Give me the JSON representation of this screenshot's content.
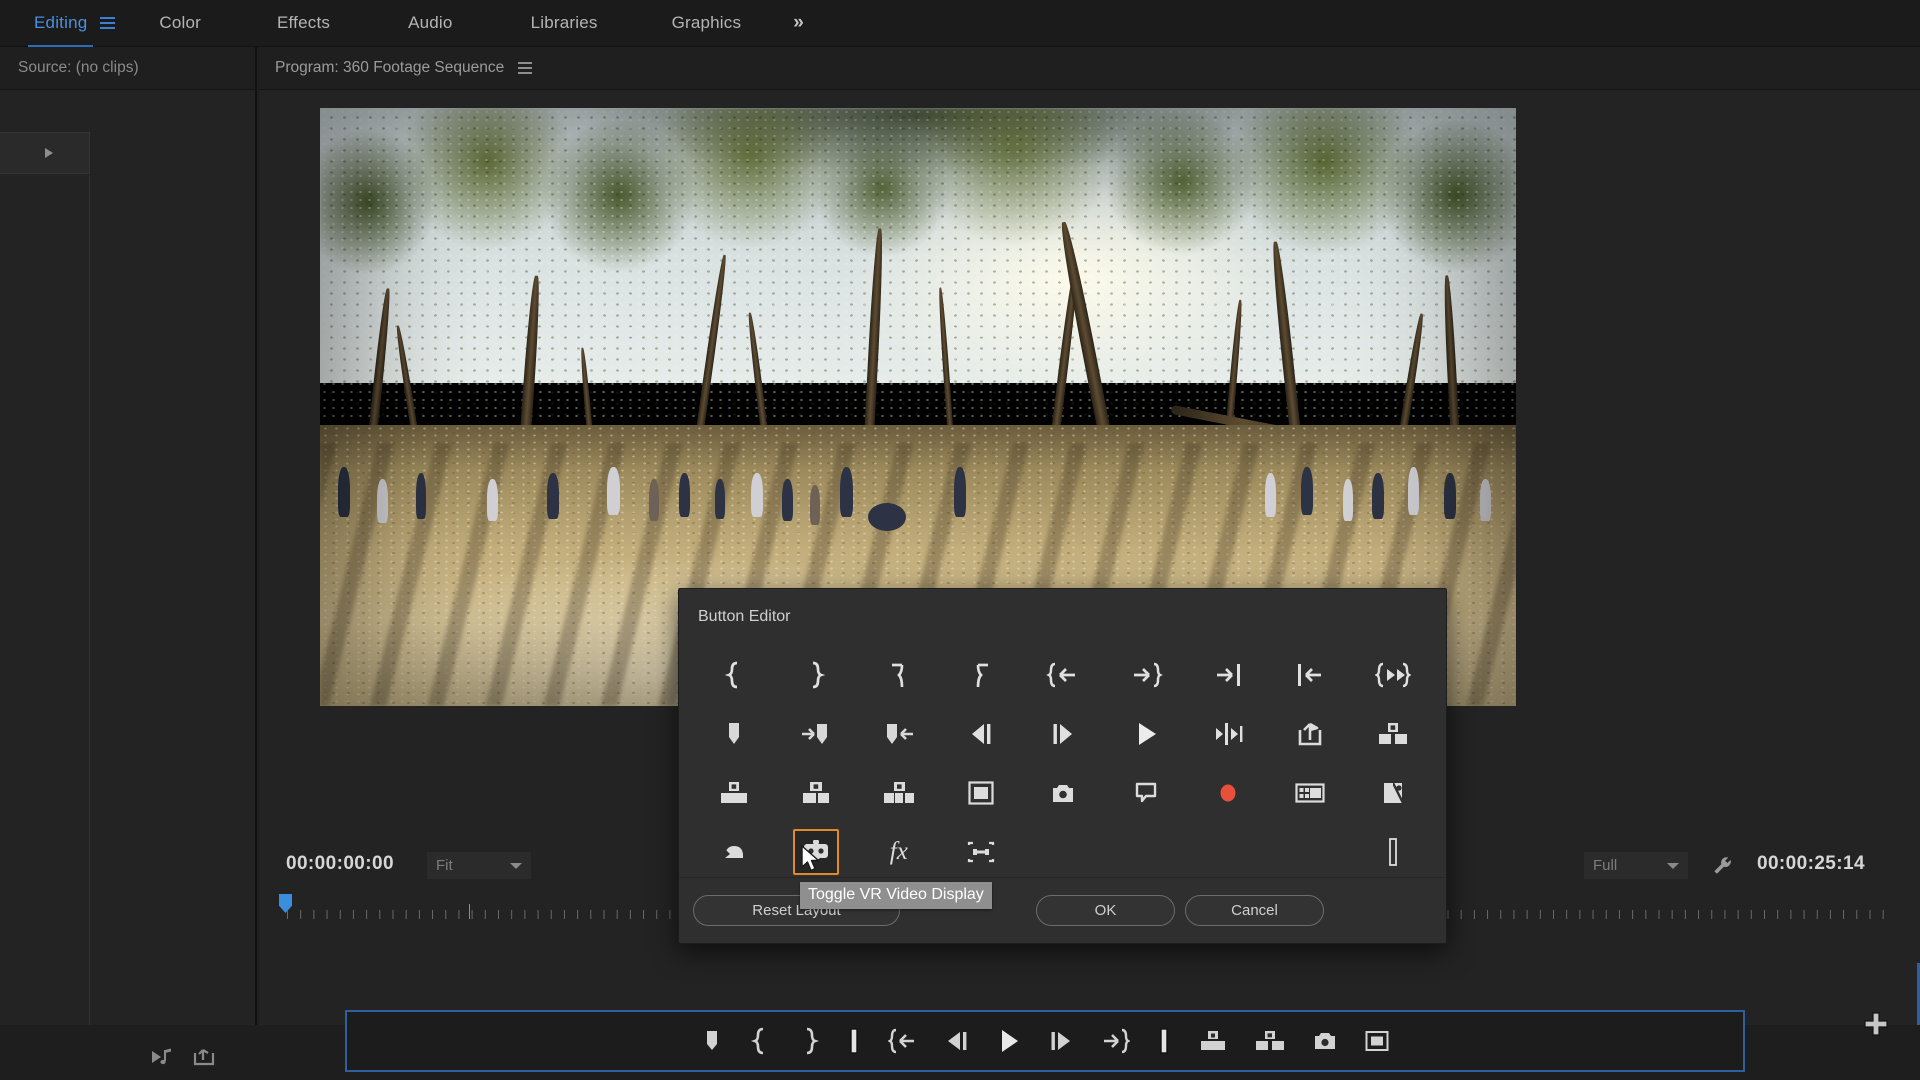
{
  "workspace": {
    "tabs": [
      {
        "label": "Editing",
        "active": true
      },
      {
        "label": "Color",
        "active": false
      },
      {
        "label": "Effects",
        "active": false
      },
      {
        "label": "Audio",
        "active": false
      },
      {
        "label": "Libraries",
        "active": false
      },
      {
        "label": "Graphics",
        "active": false
      }
    ],
    "hamburger_icon": "workspace-menu-icon",
    "overflow_label": "»",
    "active_accent": "#4a8fe0"
  },
  "source_panel": {
    "tab_label": "Source: (no clips)",
    "bottom_icons": [
      {
        "name": "export-audio-icon"
      },
      {
        "name": "export-frame-icon"
      }
    ]
  },
  "program_panel": {
    "tab_label": "Program: 360 Footage Sequence",
    "menu_icon": "panel-menu-icon",
    "timecode_current": "00:00:00:00",
    "timecode_duration": "00:00:25:14",
    "zoom_level": "Fit",
    "resolution": "Full",
    "settings_icon": "wrench-icon",
    "playhead_position_pct": 0.4
  },
  "button_bar": {
    "accent_border": "#2f5f9e",
    "buttons": [
      {
        "name": "marker-button",
        "icon": "marker"
      },
      {
        "name": "mark-in-button",
        "icon": "mark-in"
      },
      {
        "name": "mark-out-button",
        "icon": "mark-out"
      },
      {
        "name": "go-to-in-button",
        "icon": "bar-bracket"
      },
      {
        "name": "go-to-previous-marker-button",
        "icon": "bracket-left-arrow"
      },
      {
        "name": "step-back-button",
        "icon": "step-back"
      },
      {
        "name": "play-stop-button",
        "icon": "play"
      },
      {
        "name": "step-forward-button",
        "icon": "step-forward"
      },
      {
        "name": "go-to-next-marker-button",
        "icon": "arrow-right-bracket"
      },
      {
        "name": "go-to-out-button",
        "icon": "bar-bracket"
      },
      {
        "name": "lift-button",
        "icon": "lift"
      },
      {
        "name": "extract-button",
        "icon": "extract"
      },
      {
        "name": "export-frame-button",
        "icon": "camera"
      },
      {
        "name": "comparison-view-button",
        "icon": "comparison-view"
      }
    ],
    "add_icon": "add-button-icon"
  },
  "button_editor": {
    "title": "Button Editor",
    "reset_label": "Reset Layout",
    "ok_label": "OK",
    "cancel_label": "Cancel",
    "selected_index": 28,
    "selection_color": "#e08a29",
    "tooltip": "Toggle VR Video Display",
    "items": [
      {
        "name": "mark-in-button",
        "icon": "mark-in"
      },
      {
        "name": "mark-out-button",
        "icon": "mark-out"
      },
      {
        "name": "mark-clip-in-button",
        "icon": "mark-clip-right"
      },
      {
        "name": "mark-clip-out-button",
        "icon": "mark-clip-left"
      },
      {
        "name": "go-to-in-button",
        "icon": "bracket-left-arrow"
      },
      {
        "name": "go-to-out-button",
        "icon": "arrow-right-bracket"
      },
      {
        "name": "go-to-next-edit-button",
        "icon": "arrow-right-bar"
      },
      {
        "name": "go-to-previous-edit-button",
        "icon": "bar-left-arrow"
      },
      {
        "name": "play-in-to-out-button",
        "icon": "bracket-play-bracket"
      },
      {
        "name": "add-marker-button",
        "icon": "marker"
      },
      {
        "name": "go-to-next-marker-button",
        "icon": "arrow-marker"
      },
      {
        "name": "go-to-previous-marker-button",
        "icon": "marker-arrow"
      },
      {
        "name": "step-back-button",
        "icon": "step-back"
      },
      {
        "name": "step-forward-button",
        "icon": "step-forward"
      },
      {
        "name": "play-stop-toggle-button",
        "icon": "play"
      },
      {
        "name": "play-around-button",
        "icon": "play-around"
      },
      {
        "name": "export-frame-button",
        "icon": "export-frame"
      },
      {
        "name": "extract-button",
        "icon": "extract"
      },
      {
        "name": "lift-button",
        "icon": "lift"
      },
      {
        "name": "overwrite-button",
        "icon": "overwrite"
      },
      {
        "name": "insert-button",
        "icon": "insert"
      },
      {
        "name": "safe-margins-button",
        "icon": "safe-margins"
      },
      {
        "name": "export-frame-camera-button",
        "icon": "camera"
      },
      {
        "name": "add-comment-button",
        "icon": "comment"
      },
      {
        "name": "record-button",
        "icon": "record-dot",
        "color": "#e8503a"
      },
      {
        "name": "multi-camera-button",
        "icon": "multi-camera"
      },
      {
        "name": "comparison-view-button",
        "icon": "comparison-view"
      },
      {
        "name": "undo-button",
        "icon": "undo"
      },
      {
        "name": "toggle-vr-video-display-button",
        "icon": "vr-headset"
      },
      {
        "name": "effects-fx-button",
        "icon": "fx"
      },
      {
        "name": "transform-handles-button",
        "icon": "transform-handles"
      },
      {
        "name": "blank-spacer-1",
        "icon": "blank"
      },
      {
        "name": "blank-spacer-2",
        "icon": "blank"
      },
      {
        "name": "blank-spacer-3",
        "icon": "blank"
      },
      {
        "name": "spacer-bar-button",
        "icon": "spacer-bar"
      }
    ]
  }
}
